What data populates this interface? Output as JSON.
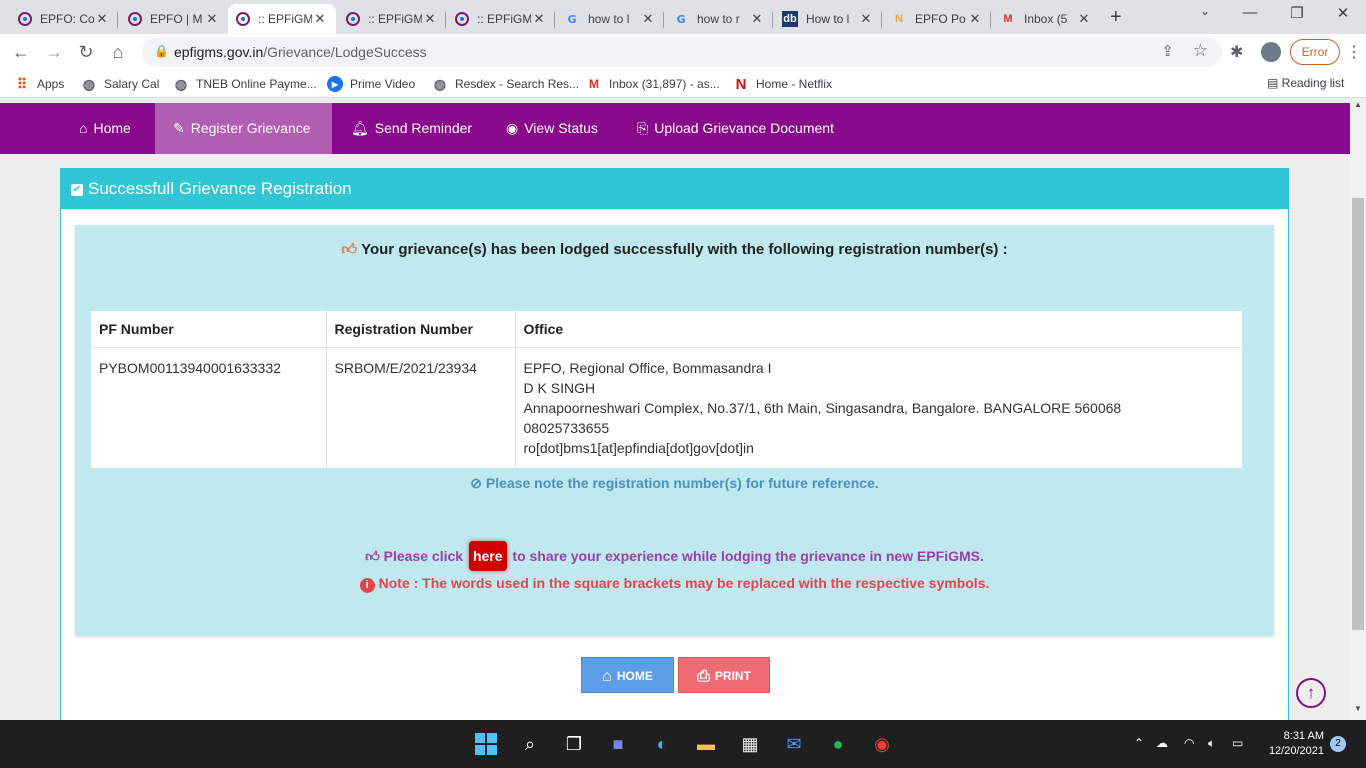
{
  "browser": {
    "tabs": [
      {
        "title": "EPFO: Co",
        "favicon": "epfo-icon"
      },
      {
        "title": "EPFO | M",
        "favicon": "epfo-icon"
      },
      {
        "title": ":: EPFiGM",
        "favicon": "epfo-icon",
        "active": true
      },
      {
        "title": ":: EPFiGM",
        "favicon": "epfo-icon"
      },
      {
        "title": ":: EPFiGM",
        "favicon": "epfo-icon"
      },
      {
        "title": "how to l",
        "favicon": "google-icon"
      },
      {
        "title": "how to r",
        "favicon": "google-icon"
      },
      {
        "title": "How to l",
        "favicon": "db-icon"
      },
      {
        "title": "EPFO Po",
        "favicon": "n-icon"
      },
      {
        "title": "Inbox (5",
        "favicon": "gmail-icon"
      }
    ],
    "url_host": "epfigms.gov.in",
    "url_path": "/Grievance/LodgeSuccess",
    "error_label": "Error",
    "bookmarks": [
      {
        "label": "Apps",
        "icon": "apps-grid-icon"
      },
      {
        "label": "Salary Cal",
        "icon": "globe-icon"
      },
      {
        "label": "TNEB Online Payme...",
        "icon": "globe-icon"
      },
      {
        "label": "Prime Video",
        "icon": "prime-video-icon"
      },
      {
        "label": "Resdex - Search Res...",
        "icon": "globe-icon"
      },
      {
        "label": "Inbox (31,897) - as...",
        "icon": "gmail-icon"
      },
      {
        "label": "Home - Netflix",
        "icon": "netflix-icon"
      }
    ],
    "reading_list": "Reading list"
  },
  "site_nav": {
    "items": [
      {
        "label": "Home",
        "icon": "home-icon"
      },
      {
        "label": "Register Grievance",
        "icon": "edit-icon",
        "active": true
      },
      {
        "label": "Send Reminder",
        "icon": "bell-icon"
      },
      {
        "label": "View Status",
        "icon": "eye-icon"
      },
      {
        "label": "Upload Grievance Document",
        "icon": "upload-icon"
      }
    ],
    "color": "#880a8a",
    "active_color": "#b15db2"
  },
  "panel": {
    "title": "Successfull Grievance Registration",
    "success_message": "Your grievance(s) has been lodged successfully with the following registration number(s) :",
    "table": {
      "headers": [
        "PF Number",
        "Registration Number",
        "Office"
      ],
      "rows": [
        {
          "pf_number": "PYBOM00113940001633332",
          "registration_number": "SRBOM/E/2021/23934",
          "office_lines": [
            "EPFO, Regional Office, Bommasandra I",
            "D K SINGH",
            "Annapoorneshwari Complex, No.37/1, 6th Main, Singasandra, Bangalore. BANGALORE 560068",
            "08025733655",
            "ro[dot]bms1[at]epfindia[dot]gov[dot]in"
          ]
        }
      ]
    },
    "reference_note": "Please note the registration number(s) for future reference.",
    "feedback_prefix": "Please click",
    "feedback_link": "here",
    "feedback_suffix": "to share your experience while lodging the grievance in new EPFiGMS.",
    "warning_note": "Note : The words used in the square brackets may be replaced with the respective symbols.",
    "home_button": "HOME",
    "print_button": "PRINT",
    "header_color": "#31c6d6"
  },
  "taskbar": {
    "time": "8:31 AM",
    "date": "12/20/2021",
    "notifications": "2"
  }
}
